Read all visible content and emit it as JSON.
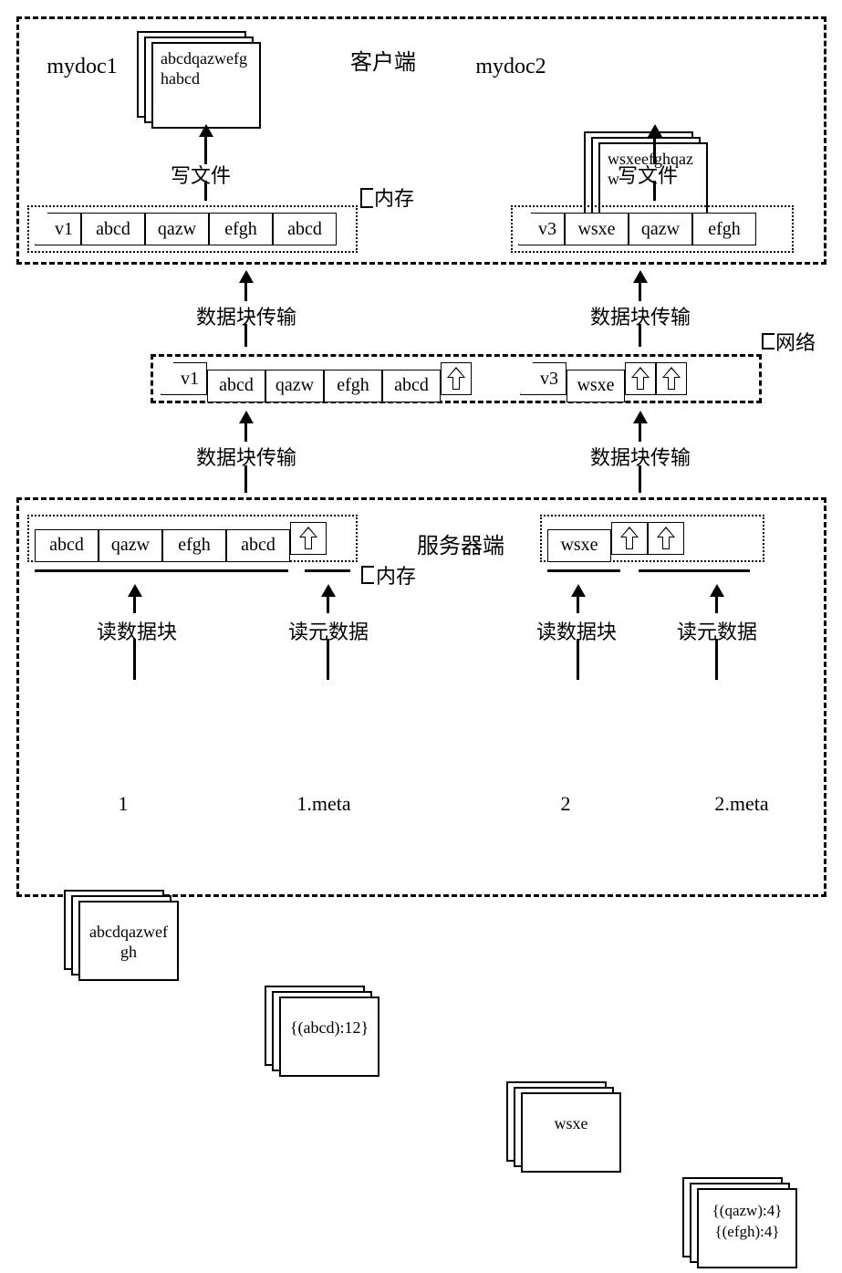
{
  "client": {
    "title": "客户端",
    "mydoc1_label": "mydoc1",
    "mydoc2_label": "mydoc2",
    "doc1_content": "abcdqazwefghabcd",
    "doc2_content": "wsxeefghqazw",
    "write_file_label": "写文件",
    "memory_label": "内存",
    "mem1": {
      "tag": "v1",
      "c1": "abcd",
      "c2": "qazw",
      "c3": "efgh",
      "c4": "abcd"
    },
    "mem2": {
      "tag": "v3",
      "c1": "wsxe",
      "c2": "qazw",
      "c3": "efgh"
    }
  },
  "transfer_label": "数据块传输",
  "network": {
    "label": "网络",
    "row_a": {
      "tag": "v1",
      "c1": "abcd",
      "c2": "qazw",
      "c3": "efgh",
      "c4": "abcd"
    },
    "row_b": {
      "tag": "v3",
      "c1": "wsxe"
    }
  },
  "server": {
    "title": "服务器端",
    "memory_label": "内存",
    "read_block_label": "读数据块",
    "read_meta_label": "读元数据",
    "mem1": {
      "c1": "abcd",
      "c2": "qazw",
      "c3": "efgh",
      "c4": "abcd"
    },
    "mem2": {
      "c1": "wsxe"
    },
    "file1": {
      "name": "1",
      "content": "abcdqazwefgh"
    },
    "file1_meta": {
      "name": "1.meta",
      "content": "{(abcd):12}"
    },
    "file2": {
      "name": "2",
      "content": "wsxe"
    },
    "file2_meta": {
      "name": "2.meta",
      "line1": "{(qazw):4}",
      "line2": "{(efgh):4}"
    }
  }
}
